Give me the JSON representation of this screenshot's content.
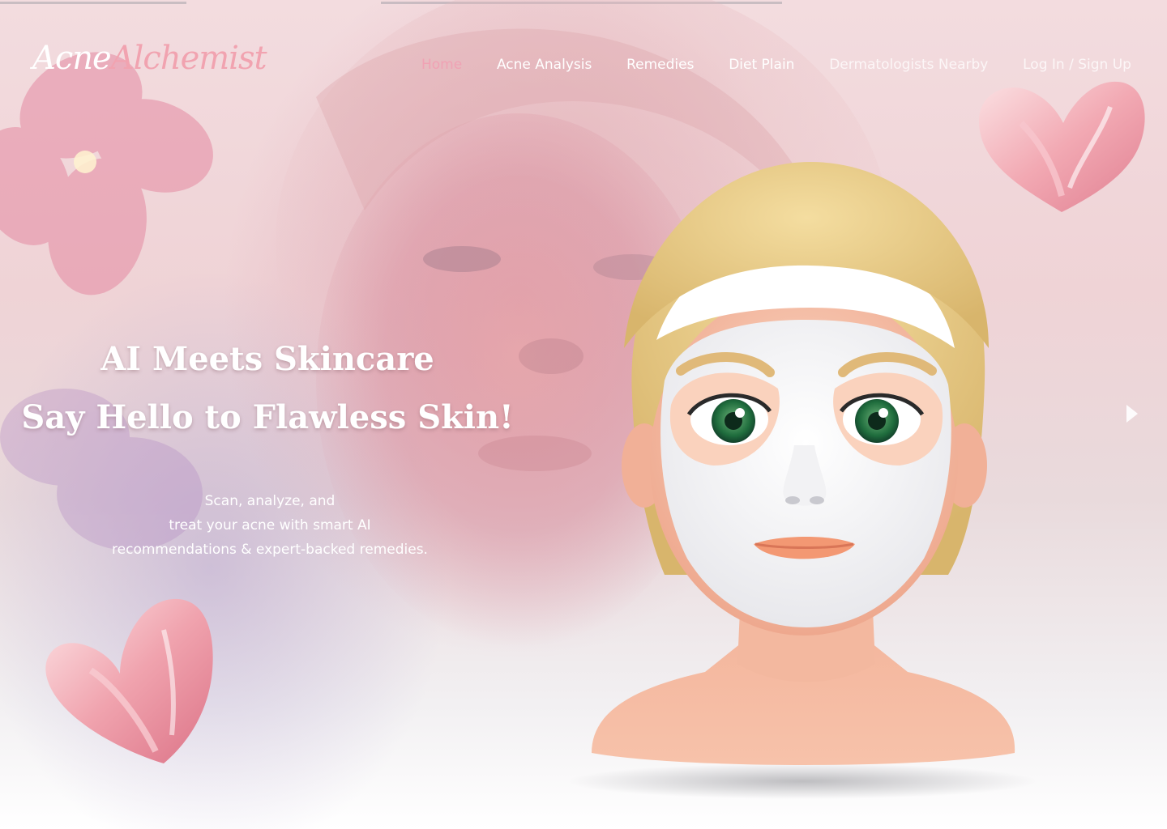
{
  "brand": {
    "logo_word1": "Acne",
    "logo_word2": "Alchemist"
  },
  "nav": {
    "items": [
      {
        "label": "Home",
        "state": "active"
      },
      {
        "label": "Acne Analysis",
        "state": "default"
      },
      {
        "label": "Remedies",
        "state": "default"
      },
      {
        "label": "Diet Plain",
        "state": "default"
      },
      {
        "label": "Dermatologists Nearby",
        "state": "faded"
      },
      {
        "label": "Log In / Sign Up",
        "state": "faded"
      }
    ]
  },
  "hero": {
    "title_line1": "AI Meets Skincare",
    "title_line2": "Say Hello to Flawless Skin!",
    "subtitle_lines": [
      "Scan, analyze, and",
      "treat your acne with smart AI",
      "recommendations & expert-backed remedies."
    ]
  },
  "icons": {
    "next": "chevron-right-icon",
    "mascot": "face-mask-mascot-illustration",
    "decor": "pink-heart-decoration"
  },
  "colors": {
    "accent_pink": "#f0a2b4",
    "text_white": "#ffffff",
    "background_blush": "#efd3d6"
  }
}
